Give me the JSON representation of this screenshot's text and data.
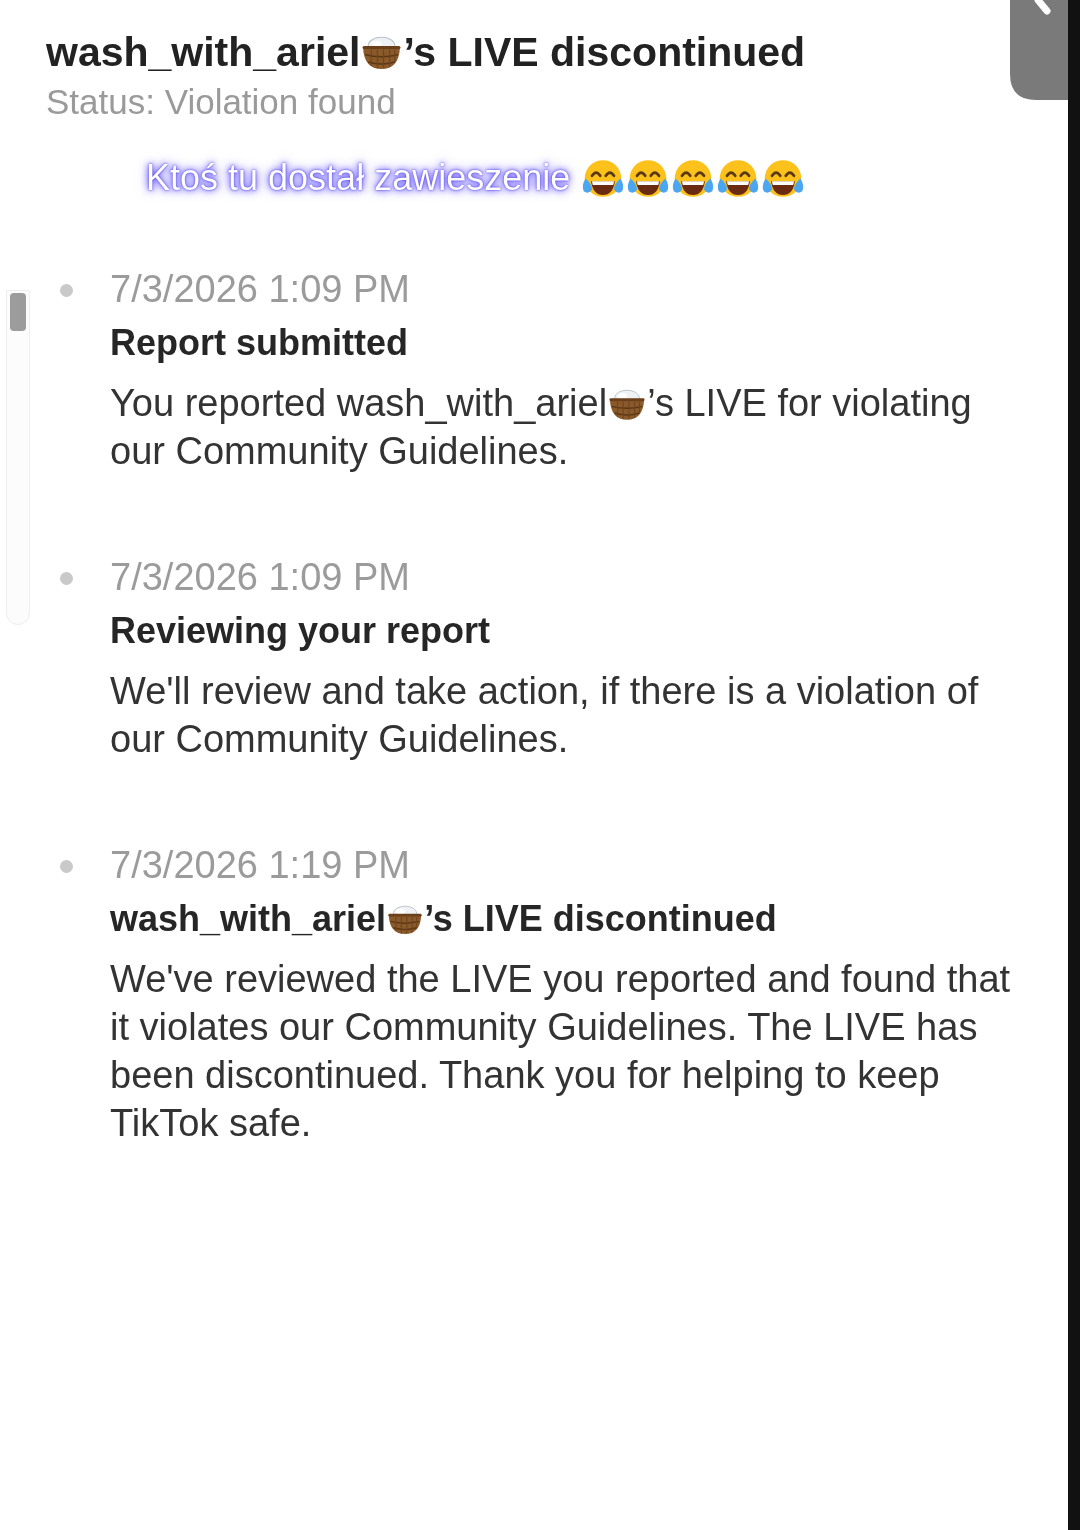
{
  "header": {
    "title": [
      {
        "kind": "text",
        "text": "wash_with_ariel"
      },
      {
        "kind": "basket"
      },
      {
        "kind": "text",
        "text": "’s LIVE discontinued"
      }
    ],
    "status": "Status: Violation found"
  },
  "caption": [
    {
      "kind": "text",
      "text": "Ktoś tu dostał zawieszenie"
    },
    {
      "kind": "joy"
    },
    {
      "kind": "joy"
    },
    {
      "kind": "joy"
    },
    {
      "kind": "joy"
    },
    {
      "kind": "joy"
    }
  ],
  "timeline": [
    {
      "time": "7/3/2026 1:09 PM",
      "title": [
        {
          "kind": "text",
          "text": "Report submitted"
        }
      ],
      "body": [
        {
          "kind": "text",
          "text": "You reported wash_with_ariel"
        },
        {
          "kind": "basket"
        },
        {
          "kind": "text",
          "text": "’s LIVE for violating our Community Guidelines."
        }
      ]
    },
    {
      "time": "7/3/2026 1:09 PM",
      "title": [
        {
          "kind": "text",
          "text": "Reviewing your report"
        }
      ],
      "body": [
        {
          "kind": "text",
          "text": "We'll review and take action, if there is a violation of our Community Guidelines."
        }
      ]
    },
    {
      "time": "7/3/2026 1:19 PM",
      "title": [
        {
          "kind": "text",
          "text": "wash_with_ariel"
        },
        {
          "kind": "basket"
        },
        {
          "kind": "text",
          "text": "’s LIVE discontinued"
        }
      ],
      "body": [
        {
          "kind": "text",
          "text": "We've reviewed the LIVE you reported and found that it violates our Community Guidelines. The LIVE has been discontinued. Thank you for helping to keep TikTok safe."
        }
      ]
    }
  ]
}
